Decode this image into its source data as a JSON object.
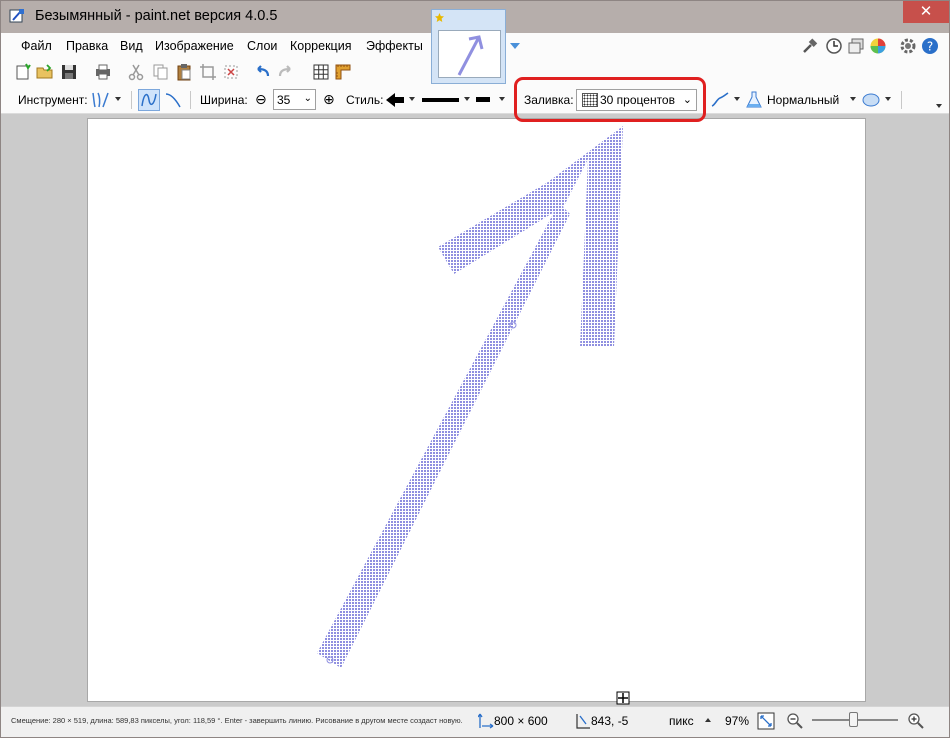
{
  "window": {
    "title": "Безымянный - paint.net версия 4.0.5",
    "close_glyph": "✕"
  },
  "menu": {
    "items": [
      "Файл",
      "Правка",
      "Вид",
      "Изображение",
      "Слои",
      "Коррекция",
      "Эффекты"
    ]
  },
  "toolbar": {
    "instrument_label": "Инструмент:",
    "width_label": "Ширина:",
    "width_value": "35",
    "style_label": "Стиль:",
    "fill_label": "Заливка:",
    "fill_value": "30 процентов",
    "blend_mode": "Нормальный",
    "minus_glyph": "⊖",
    "plus_glyph": "⊕",
    "chevron_glyph": "⌄"
  },
  "status": {
    "hint": "Смещение: 280 × 519, длина: 589,83 пикселы, угол: 118,59 °. Enter - завершить линию. Рисование в другом месте создаст новую.",
    "image_size": "800 × 600",
    "cursor_pos": "843, -5",
    "units": "пикс",
    "zoom": "97%"
  },
  "colors": {
    "arrow_fill": "#8f8fe0",
    "highlight": "#e02020",
    "close_button": "#c7504b"
  }
}
